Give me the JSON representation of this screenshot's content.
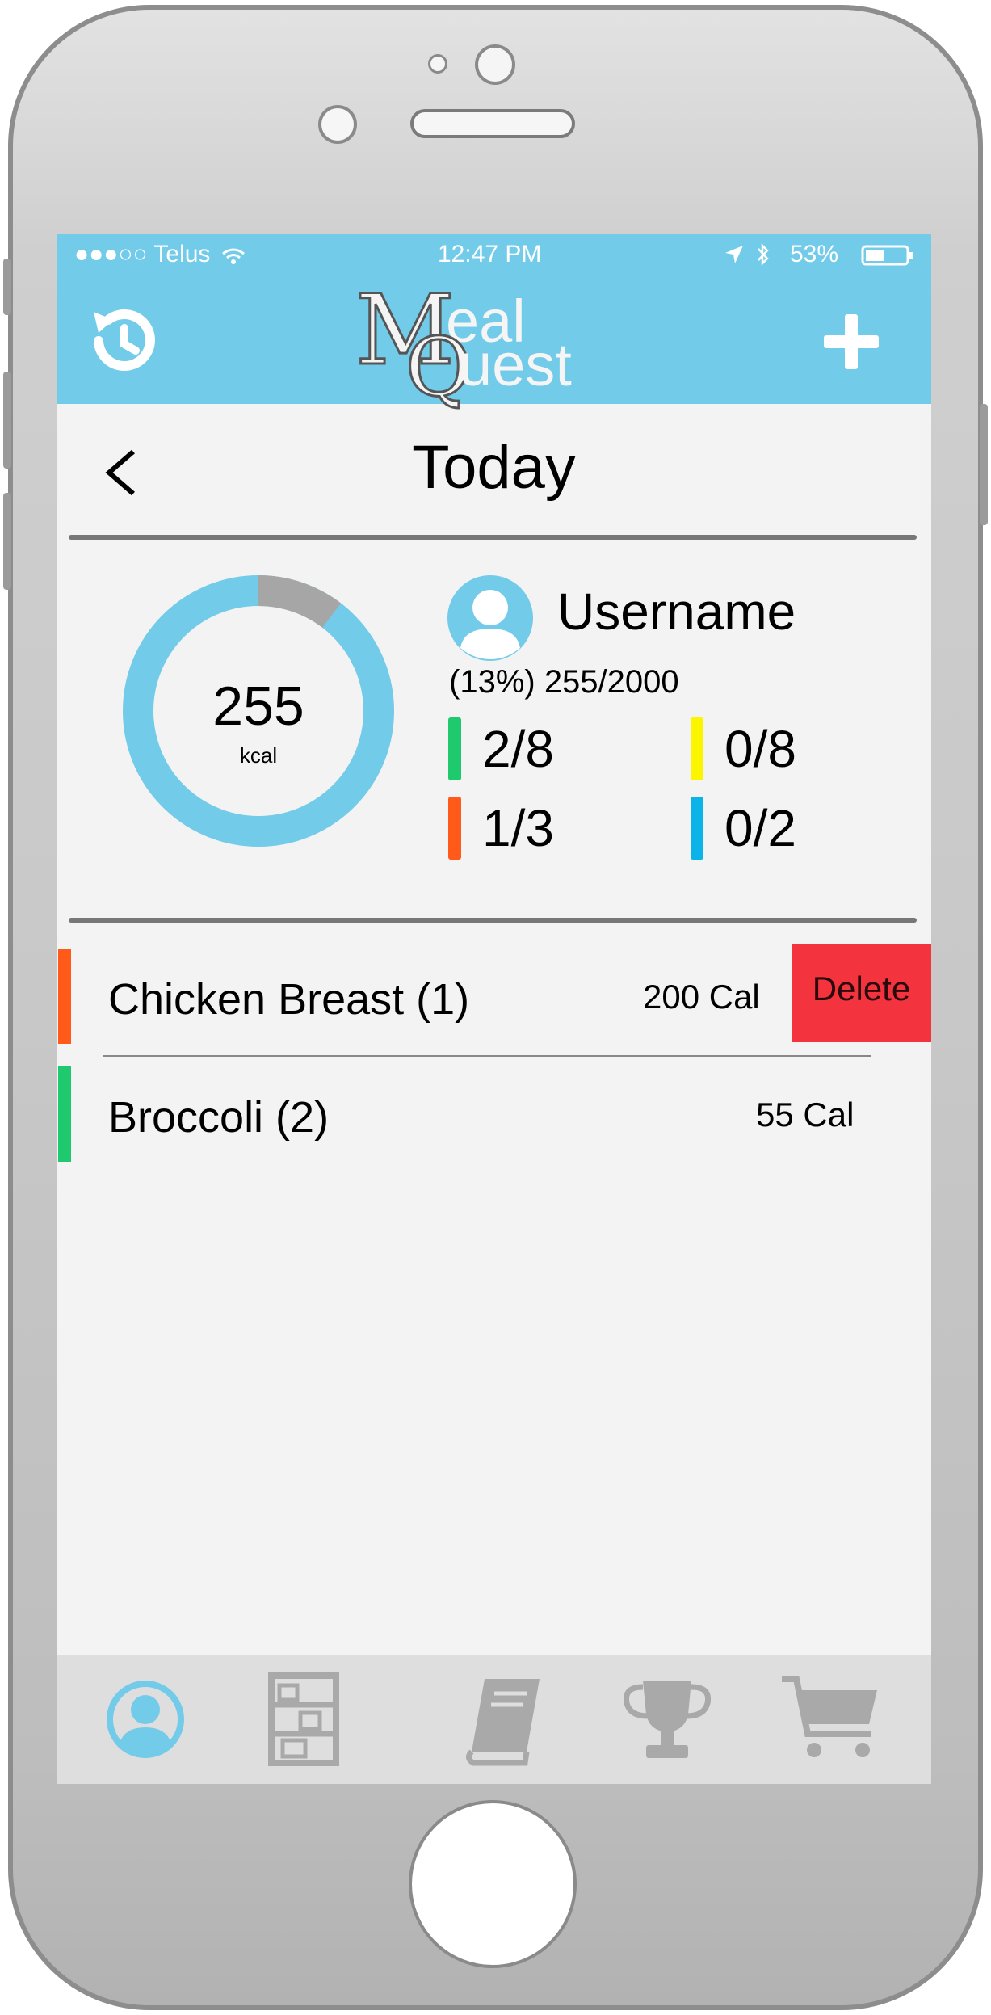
{
  "status_bar": {
    "carrier": "●●●○○ Telus",
    "time": "12:47 PM",
    "battery": "53%"
  },
  "app": {
    "logo_letter_m": "M",
    "logo_top": "eal",
    "logo_letter_q": "Q",
    "logo_bottom": "uest",
    "accent_color": "#72cbe9"
  },
  "header": {
    "history_icon": "history-icon",
    "add_icon": "plus-icon"
  },
  "page": {
    "title": "Today"
  },
  "summary": {
    "calories_value": "255",
    "calories_unit": "kcal",
    "ring_progress": 0.13,
    "username": "Username",
    "progress_text": "(13%) 255/2000",
    "food_groups": [
      {
        "color": "#1fc96e",
        "value": "2/8"
      },
      {
        "color": "#fbf500",
        "value": "0/8"
      },
      {
        "color": "#ff5a1a",
        "value": "1/3"
      },
      {
        "color": "#0bb3e8",
        "value": "0/2"
      }
    ]
  },
  "entries": [
    {
      "name": "Chicken Breast (1)",
      "calories": "200 Cal",
      "color": "#ff5a1a",
      "action": "Delete"
    },
    {
      "name": "Broccoli (2)",
      "calories": "55 Cal",
      "color": "#1fc96e"
    }
  ],
  "tabs": [
    "profile-tab",
    "pantry-tab",
    "recipes-tab",
    "achievements-tab",
    "shopping-cart-tab"
  ]
}
